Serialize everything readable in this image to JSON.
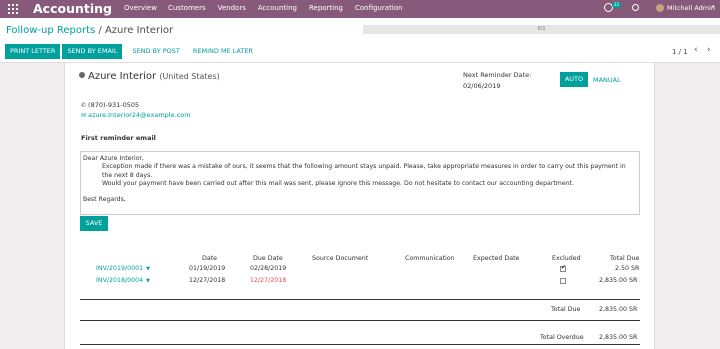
{
  "topbar": {
    "app_title": "Accounting",
    "menu": [
      "Overview",
      "Customers",
      "Vendors",
      "Accounting",
      "Reporting",
      "Configuration"
    ],
    "chat_badge": "22",
    "user_name": "Mitchell Admin"
  },
  "control_panel": {
    "breadcrumb_parent": "Follow-up Reports",
    "breadcrumb_sep": "/",
    "breadcrumb_current": "Azure Interior",
    "progress_label": "0/1",
    "buttons": {
      "print": "PRINT LETTER",
      "email": "SEND BY EMAIL",
      "post": "SEND BY POST",
      "remind": "REMIND ME LATER"
    },
    "pager": "1 / 1"
  },
  "report": {
    "partner_name": "Azure Interior",
    "partner_country": "(United States)",
    "next_reminder_label": "Next Reminder Date:",
    "next_reminder_value": "02/06/2019",
    "auto_label": "AUTO",
    "manual_label": "MANUAL",
    "phone": "(870)-931-0505",
    "email": "azure.Interior24@example.com",
    "section_title": "First reminder email",
    "letter": {
      "greeting": "Dear Azure Interior,",
      "p1": "Exception made if there was a mistake of ours, it seems that the following amount stays unpaid. Please, take appropriate measures in order to carry out this payment in the next 8 days.",
      "p2": "Would your payment have been carried out after this mail was sent, please ignore this message. Do not hesitate to contact our accounting department.",
      "closing": "Best Regards,"
    },
    "save_label": "SAVE",
    "table": {
      "headers": {
        "date": "Date",
        "due_date": "Due Date",
        "source": "Source Document",
        "communication": "Communication",
        "expected": "Expected Date",
        "excluded": "Excluded",
        "total_due": "Total Due"
      },
      "rows": [
        {
          "invoice": "INV/2019/0001",
          "date": "01/19/2019",
          "due_date": "02/28/2019",
          "excluded": true,
          "total_due": "2.50 SR"
        },
        {
          "invoice": "INV/2018/0004",
          "date": "12/27/2018",
          "due_date": "12/27/2018",
          "excluded": false,
          "total_due": "2,835.00 SR"
        }
      ],
      "total_due_label": "Total Due",
      "total_due_value": "2,835.00 SR",
      "total_overdue_label": "Total Overdue",
      "total_overdue_value": "2,835.00 SR"
    }
  },
  "colors": {
    "brand": "#875a7b",
    "accent": "#00a09d",
    "overdue": "#e84a4a"
  }
}
